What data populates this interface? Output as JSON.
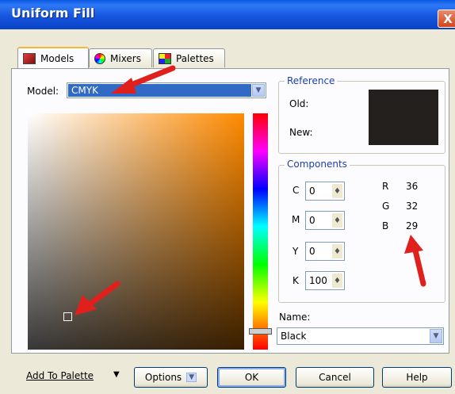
{
  "window": {
    "title": "Uniform Fill",
    "close_glyph": "X"
  },
  "tabs": [
    {
      "label": "Models",
      "icon": "models-icon"
    },
    {
      "label": "Mixers",
      "icon": "mixers-icon"
    },
    {
      "label": "Palettes",
      "icon": "palettes-icon"
    }
  ],
  "model": {
    "label": "Model:",
    "value": "CMYK"
  },
  "reference": {
    "title": "Reference",
    "old_label": "Old:",
    "new_label": "New:",
    "color": "#24201d"
  },
  "components": {
    "title": "Components",
    "cmyk": [
      {
        "label": "C",
        "value": "0"
      },
      {
        "label": "M",
        "value": "0"
      },
      {
        "label": "Y",
        "value": "0"
      },
      {
        "label": "K",
        "value": "100"
      }
    ],
    "rgb": [
      {
        "label": "R",
        "value": "36"
      },
      {
        "label": "G",
        "value": "32"
      },
      {
        "label": "B",
        "value": "29"
      }
    ]
  },
  "name": {
    "label": "Name:",
    "value": "Black"
  },
  "footer": {
    "add_to_palette": "Add To Palette",
    "options": "Options",
    "ok": "OK",
    "cancel": "Cancel",
    "help": "Help"
  },
  "colors": {
    "title_bar": "#0a58e5",
    "selection": "#316ac5",
    "annotation_arrow": "#e0201c",
    "group_label": "#1e3fa6"
  }
}
